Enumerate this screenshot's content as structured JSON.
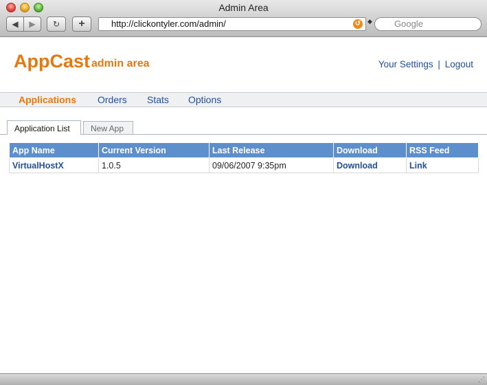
{
  "window": {
    "title": "Admin Area",
    "url": "http://clickontyler.com/admin/",
    "search_placeholder": "Google"
  },
  "header": {
    "logo": "AppCast",
    "logo_sub": "admin area",
    "settings_link": "Your Settings",
    "separator": "|",
    "logout_link": "Logout"
  },
  "nav": {
    "items": [
      {
        "label": "Applications",
        "active": true
      },
      {
        "label": "Orders"
      },
      {
        "label": "Stats"
      },
      {
        "label": "Options"
      }
    ]
  },
  "tabs": [
    {
      "label": "Application List",
      "active": true
    },
    {
      "label": "New App"
    }
  ],
  "table": {
    "headers": [
      "App Name",
      "Current Version",
      "Last Release",
      "Download",
      "RSS Feed"
    ],
    "rows": [
      [
        "VirtualHostX",
        "1.0.5",
        "09/06/2007 9:35pm",
        "Download",
        "Link"
      ]
    ]
  },
  "colors": {
    "brand_orange": "#e47911",
    "link_blue": "#224f99",
    "table_header": "#5d8fcc"
  }
}
